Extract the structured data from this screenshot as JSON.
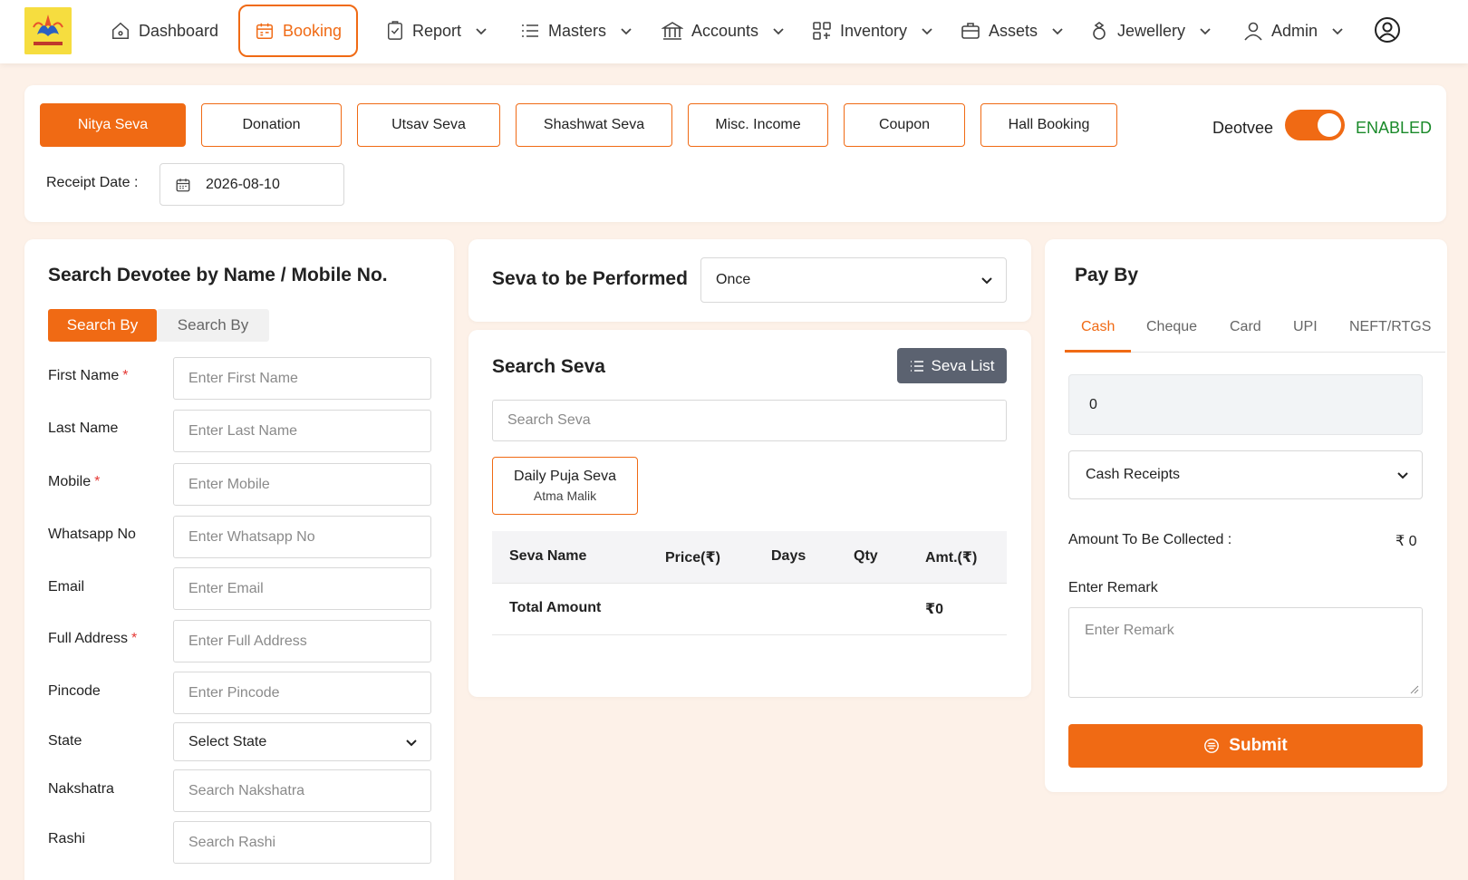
{
  "nav": {
    "items": [
      {
        "label": "Dashboard"
      },
      {
        "label": "Booking"
      },
      {
        "label": "Report"
      },
      {
        "label": "Masters"
      },
      {
        "label": "Accounts"
      },
      {
        "label": "Inventory"
      },
      {
        "label": "Assets"
      },
      {
        "label": "Jewellery"
      },
      {
        "label": "Admin"
      }
    ]
  },
  "booking_tabs": [
    "Nitya Seva",
    "Donation",
    "Utsav Seva",
    "Shashwat Seva",
    "Misc. Income",
    "Coupon",
    "Hall Booking"
  ],
  "deotvee": {
    "label": "Deotvee",
    "status": "ENABLED",
    "enabled": true
  },
  "receipt": {
    "label": "Receipt Date :",
    "value": "2026-08-10"
  },
  "devotee": {
    "title": "Search Devotee by Name / Mobile No.",
    "search_tabs": [
      "Search By",
      "Search By"
    ],
    "fields": [
      {
        "label": "First Name",
        "required": "*",
        "placeholder": "Enter First Name"
      },
      {
        "label": "Last Name",
        "required": "",
        "placeholder": "Enter Last Name"
      },
      {
        "label": "Mobile",
        "required": "*",
        "placeholder": "Enter Mobile"
      },
      {
        "label": "Whatsapp No",
        "required": "",
        "placeholder": "Enter Whatsapp No"
      },
      {
        "label": "Email",
        "required": "",
        "placeholder": "Enter Email"
      },
      {
        "label": "Full Address",
        "required": "*",
        "placeholder": "Enter Full Address"
      },
      {
        "label": "Pincode",
        "required": "",
        "placeholder": "Enter Pincode"
      },
      {
        "label": "State",
        "required": "",
        "placeholder": "Select State"
      },
      {
        "label": "Nakshatra",
        "required": "",
        "placeholder": "Search Nakshatra"
      },
      {
        "label": "Rashi",
        "required": "",
        "placeholder": "Search Rashi"
      }
    ]
  },
  "seva_perform": {
    "label": "Seva to be Performed",
    "value": "Once"
  },
  "search_seva": {
    "title": "Search Seva",
    "list_button": "Seva List",
    "placeholder": "Search Seva",
    "card": {
      "name": "Daily Puja Seva",
      "sub": "Atma Malik"
    },
    "columns": [
      "Seva Name",
      "Price(₹)",
      "Days",
      "Qty",
      "Amt.(₹)"
    ],
    "total_label": "Total Amount",
    "total_value": "₹0"
  },
  "pay": {
    "title": "Pay By",
    "tabs": [
      "Cash",
      "Cheque",
      "Card",
      "UPI",
      "NEFT/RTGS"
    ],
    "amount": "0",
    "receipt_type": "Cash Receipts",
    "collect_label": "Amount To Be Collected :",
    "collect_value": "₹ 0",
    "remark_label": "Enter Remark",
    "remark_placeholder": "Enter Remark",
    "submit": "Submit"
  },
  "colors": {
    "accent": "#f06a14",
    "enabled": "#1a8a2a",
    "button_gray": "#5b6270"
  }
}
